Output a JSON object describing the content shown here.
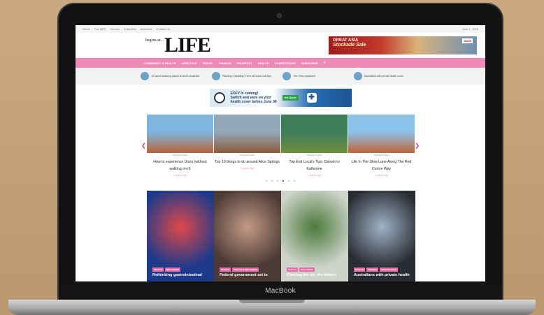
{
  "device": {
    "brand": "MacBook"
  },
  "site": {
    "topbar": {
      "links": [
        "Home",
        "The MPC",
        "Venues",
        "Subscribe",
        "Advertise",
        "Contact Us"
      ],
      "date": "June 1, 2018"
    },
    "logo": {
      "small": "begins at...",
      "large": "LIFE"
    },
    "ad": {
      "headline": "GREAT ASIA",
      "sub": "Stockade Sale",
      "tag": "SAVE"
    },
    "nav": [
      "COMMUNITY & HEALTH",
      "LIFESTYLE",
      "TRAVEL",
      "FINANCE",
      "PROPERTY",
      "HEALTH",
      "COMPETITIONS",
      "SUBSCRIBE"
    ],
    "trending": [
      "10 secret amazing places to visit in Australia",
      "Planning a wedding? Here are some real tips",
      "The Ghan explained",
      "Australians with private health cover"
    ],
    "promo": {
      "line1": "EOFY is coming!",
      "line2": "Switch and save on your",
      "line3": "health cover before June 30",
      "cta": "Get Quote"
    },
    "carousel": {
      "cards": [
        {
          "category": "Domestic Travel",
          "title": "How to experience Uluru (without walking on it)",
          "time": "1 month ago",
          "sky": "#7fb6df",
          "ground": "#b8623a"
        },
        {
          "category": "Domestic Travel",
          "title": "Top 10 things to do around Alice Springs",
          "time": "1 month ago",
          "sky": "#93a8b9",
          "ground": "#8c5a3a"
        },
        {
          "category": "Domestic Travel",
          "title": "Top End Local's Tips: Darwin to Katherine",
          "time": "1 month ago",
          "sky": "#3f7d5a",
          "ground": "#6e8f3d"
        },
        {
          "category": "Domestic Travel",
          "title": "Life In The Slow Lane Along The Red Centre Way",
          "time": "1 month ago",
          "sky": "#8bc2e8",
          "ground": "#c0643a"
        }
      ],
      "dots": 6,
      "active_dot": 3
    },
    "tiles": [
      {
        "tags": [
          "HEALTH",
          "WELLBEING"
        ],
        "headline": "Rethinking gastrointestinal",
        "bg": "#1d3a8a",
        "accent": "#e0484a"
      },
      {
        "tags": [
          "HEALTH",
          "HEALTH & WELLBEING"
        ],
        "headline": "Federal government set to",
        "bg": "#4b3a35",
        "accent": "#c49a86"
      },
      {
        "tags": [
          "HEALTH",
          "WELLBEING"
        ],
        "headline": "Clearing the air: the hidden",
        "bg": "#cfd4cb",
        "accent": "#4a7a3a"
      },
      {
        "tags": [
          "HEALTH",
          "FINANCE",
          "HEALTH CARE"
        ],
        "headline": "Australians with private health",
        "bg": "#2a2c33",
        "accent": "#9fb3c7"
      }
    ]
  }
}
